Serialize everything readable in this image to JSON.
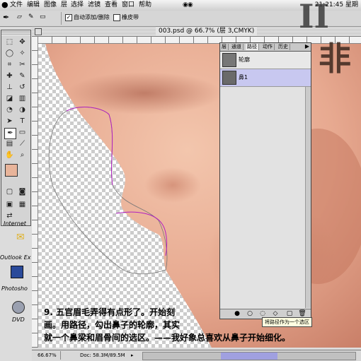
{
  "menubar": {
    "apple_icon": "apple-icon",
    "items": [
      "文件",
      "编辑",
      "图像",
      "层",
      "选择",
      "滤镜",
      "查看",
      "窗口",
      "帮助"
    ],
    "clock": "21:21:45 星期"
  },
  "options": {
    "auto_add_delete_label": "自动添加/删除",
    "auto_add_delete_checked": true,
    "rubber_band_label": "橡皮带",
    "rubber_band_checked": false
  },
  "window": {
    "title": "003.psd @ 66.7% (层 3,CMYK)"
  },
  "colors": {
    "foreground": "#e8b49a",
    "background": "#111111",
    "path_stroke": "#b020c0"
  },
  "desktop": {
    "icons": [
      "Internet",
      "Outlook Ex",
      "Photosho",
      "DVD"
    ]
  },
  "paths_panel": {
    "tabs": [
      "层",
      "通道",
      "路径",
      "动作",
      "历史"
    ],
    "active_tab": "路径",
    "paths": [
      {
        "name": "轮廓",
        "selected": false
      },
      {
        "name": "鼻1",
        "selected": true
      }
    ],
    "tooltip": "将路径作为一个选区"
  },
  "watermark": {
    "top": "II",
    "bottom": "非"
  },
  "caption": {
    "lines": [
      "9. 五官眉毛弄得有点形了。开始刻",
      "画。用路径，勾出鼻子的轮廓，其实",
      "就一个鼻梁和眉骨间的选区。——我好象总喜欢从鼻子开始细化。"
    ]
  },
  "status": {
    "zoom": "66.67%",
    "doc": "Doc: 58.3M/89.5M"
  }
}
